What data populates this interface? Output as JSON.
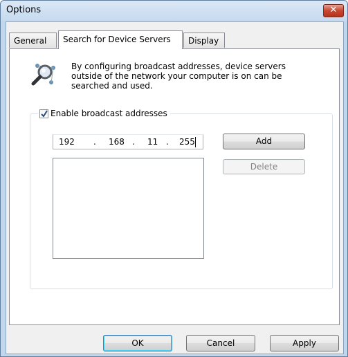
{
  "window": {
    "title": "Options",
    "close_label": "✕"
  },
  "tabs": [
    {
      "label": "General",
      "active": false
    },
    {
      "label": "Search for Device Servers",
      "active": true
    },
    {
      "label": "Display",
      "active": false
    }
  ],
  "info": {
    "icon": "magnifier-network-icon",
    "text": "By configuring broadcast addresses, device servers outside of the network your computer is on can be searched and used."
  },
  "broadcast": {
    "checkbox_label": "Enable broadcast addresses",
    "checked": true,
    "ip_octets": [
      "192",
      "168",
      "11",
      "255"
    ],
    "ip_separator": ".",
    "add_label": "Add",
    "delete_label": "Delete",
    "addresses": []
  },
  "footer": {
    "ok_label": "OK",
    "cancel_label": "Cancel",
    "apply_label": "Apply"
  },
  "colors": {
    "accent": "#3c7fb1",
    "close": "#c7462f"
  }
}
